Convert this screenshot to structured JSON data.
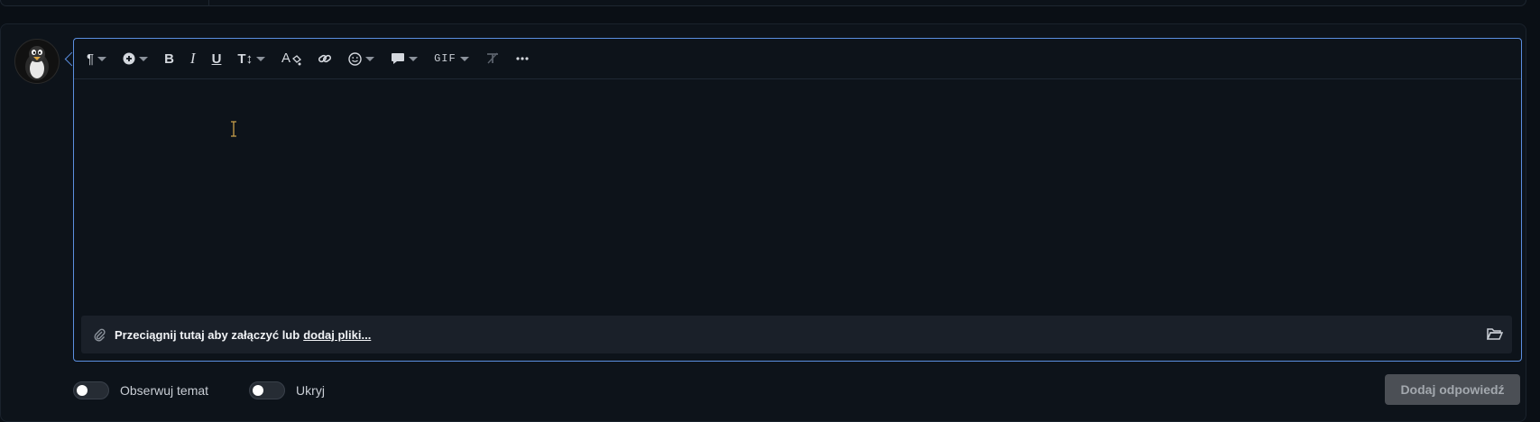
{
  "toolbar": {
    "paragraph": "¶",
    "insert": "⊕",
    "bold": "B",
    "italic": "I",
    "underline": "U",
    "text_size": "T↕",
    "font_color": "A",
    "link": "🔗",
    "emoji": "☺",
    "quote": "💬",
    "gif": "GIF",
    "clear_format": "T̸",
    "more": "•••"
  },
  "attach": {
    "text": "Przeciągnij tutaj aby załączyć lub",
    "link": "dodaj pliki..."
  },
  "options": {
    "watch_label": "Obserwuj temat",
    "hide_label": "Ukryj"
  },
  "submit_label": "Dodaj odpowiedź",
  "colors": {
    "accent_border": "#5b8fe0",
    "background": "#0a0f15",
    "submit_bg": "#4b4f55"
  }
}
